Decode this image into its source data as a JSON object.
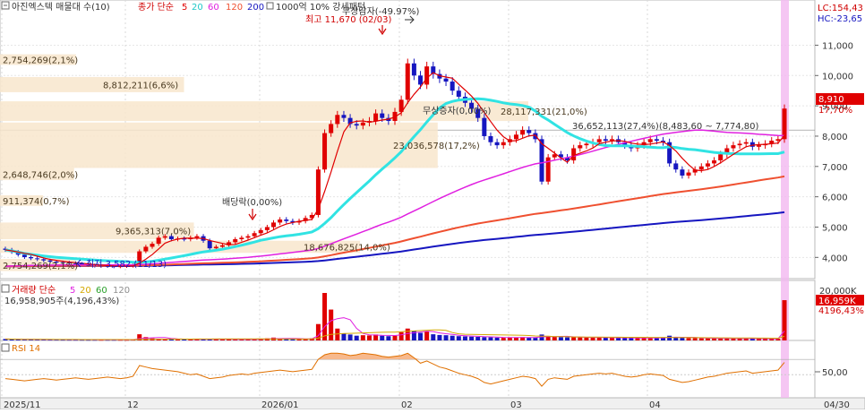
{
  "price_panel": {
    "title": "아진엑스텍 매물대 수(10)",
    "legend": {
      "ma_prefix": "종가 단순",
      "ma_periods": [
        "5",
        "20",
        "60",
        "120",
        "200"
      ],
      "ma_colors": [
        "#e00000",
        "#31e3e3",
        "#e020e0",
        "#ef5030",
        "#1616c0"
      ],
      "note": "1000억 10% 강세패턴"
    },
    "markers": {
      "high": "최고 11,670 (02/03)",
      "low": "최저 3,582 (11/13)",
      "capital_reduction": "무상감자(-49.97%)",
      "dividend": "배당락(0,00%)",
      "bonus_issue": "무상증자(0,00%)"
    },
    "range_label": "36,652,113(27,4%)(8,483,60 ~ 7,774,80)",
    "right_box": {
      "lc": "LC:154,43",
      "hc": "HC:-23,65",
      "price": "8,910",
      "change": "17,70%"
    },
    "y_ticks": [
      "11,000",
      "10,000",
      "9,000",
      "8,000",
      "7,000",
      "6,000",
      "5,000",
      "4,000"
    ]
  },
  "volume_panel": {
    "title_prefix": "거래량 단순",
    "ma_periods": [
      "5",
      "20",
      "60",
      "120"
    ],
    "ma_colors": [
      "#e020e0",
      "#e8c000",
      "#2aa02a",
      "#909090"
    ],
    "info": "16,958,905주(4,196,43%)",
    "y_tick": "20,000K",
    "last_value": "16,959K",
    "last_pct": "4196,43%"
  },
  "rsi_panel": {
    "title": "RSI 14",
    "y_tick": "50,00"
  },
  "x_axis": {
    "labels": [
      "2025/11",
      "12",
      "2026/01",
      "02",
      "03",
      "04",
      "04/30"
    ]
  },
  "chart_data": {
    "type": "candlestick",
    "y_axis_ticks": [
      4000,
      5000,
      6000,
      7000,
      8000,
      9000,
      10000,
      11000
    ],
    "ylim": [
      3300,
      11900
    ],
    "last_price": 8910,
    "high": {
      "value": 11670,
      "date": "02/03"
    },
    "low": {
      "value": 3582,
      "date": "11/13"
    },
    "volume_profile": [
      {
        "volume": "2,754,269",
        "pct": "2,1%",
        "price_low": 10350,
        "price_high": 10700
      },
      {
        "volume": "8,812,211",
        "pct": "6,6%",
        "price_low": 9450,
        "price_high": 9950
      },
      {
        "volume": "28,117,331",
        "pct": "21,0%",
        "price_low": 8500,
        "price_high": 9150
      },
      {
        "volume": "23,036,578",
        "pct": "17,2%",
        "price_low": 6950,
        "price_high": 8450
      },
      {
        "volume": "2,648,746",
        "pct": "2,0%",
        "price_low": 6550,
        "price_high": 6950
      },
      {
        "volume": "911,374",
        "pct": "0,7%",
        "price_low": 5700,
        "price_high": 6050
      },
      {
        "volume": "9,365,313",
        "pct": "7,0%",
        "price_low": 4600,
        "price_high": 5150
      },
      {
        "volume": "18,676,825",
        "pct": "14,0%",
        "price_low": 4150,
        "price_high": 4550
      },
      {
        "volume": "2,754,269",
        "pct": "2,1%",
        "price_low": 3550,
        "price_high": 3950
      }
    ],
    "closes": [
      4250,
      4180,
      4090,
      4010,
      3970,
      3940,
      3900,
      3860,
      3840,
      3830,
      3810,
      3790,
      3760,
      3740,
      3720,
      3720,
      3710,
      3700,
      3710,
      3720,
      3740,
      4200,
      4350,
      4450,
      4650,
      4700,
      4600,
      4620,
      4600,
      4650,
      4700,
      4550,
      4300,
      4350,
      4400,
      4500,
      4600,
      4650,
      4700,
      4800,
      4900,
      5000,
      5150,
      5250,
      5200,
      5150,
      5200,
      5300,
      5400,
      6900,
      8100,
      8400,
      8700,
      8600,
      8400,
      8350,
      8450,
      8500,
      8750,
      8600,
      8500,
      8800,
      9200,
      10400,
      10000,
      9700,
      10300,
      10050,
      9900,
      9800,
      9500,
      9300,
      9100,
      8900,
      8600,
      8000,
      7800,
      7700,
      7800,
      7900,
      8050,
      8200,
      8100,
      7900,
      6500,
      7300,
      7400,
      7300,
      7200,
      7600,
      7700,
      7750,
      7800,
      7900,
      7850,
      7900,
      7800,
      7700,
      7600,
      7700,
      7800,
      7900,
      7850,
      7800,
      7100,
      6900,
      6700,
      6800,
      6900,
      7000,
      7100,
      7200,
      7400,
      7600,
      7700,
      7750,
      7800,
      7650,
      7700,
      7750,
      7850,
      7900,
      8910
    ],
    "volume_values_k": [
      600,
      500,
      450,
      420,
      400,
      380,
      380,
      360,
      350,
      340,
      330,
      320,
      320,
      300,
      300,
      300,
      300,
      300,
      300,
      300,
      350,
      2600,
      1400,
      900,
      700,
      600,
      550,
      500,
      480,
      460,
      450,
      700,
      600,
      500,
      480,
      460,
      500,
      480,
      460,
      450,
      700,
      900,
      1200,
      800,
      700,
      650,
      600,
      700,
      900,
      6900,
      20000,
      13000,
      5000,
      3000,
      2500,
      2000,
      2200,
      2100,
      2500,
      2000,
      1800,
      2000,
      3500,
      5000,
      4000,
      3200,
      3800,
      2600,
      2300,
      2200,
      2000,
      1800,
      1700,
      1600,
      1500,
      1400,
      1300,
      1200,
      1100,
      1200,
      1300,
      1400,
      1200,
      1100,
      2500,
      1900,
      1500,
      1400,
      1300,
      1400,
      1300,
      1250,
      1200,
      1200,
      1150,
      1100,
      1100,
      1100,
      1000,
      1000,
      1100,
      1150,
      1100,
      1050,
      2000,
      1400,
      1100,
      1000,
      950,
      900,
      900,
      850,
      800,
      800,
      800,
      780,
      760,
      740,
      720,
      700,
      700,
      720,
      16959
    ],
    "rsi_values": [
      45,
      44,
      43,
      42,
      43,
      44,
      45,
      44,
      43,
      44,
      45,
      46,
      45,
      44,
      45,
      46,
      47,
      46,
      45,
      46,
      48,
      62,
      60,
      58,
      57,
      56,
      55,
      54,
      52,
      50,
      51,
      48,
      45,
      46,
      47,
      49,
      50,
      51,
      50,
      52,
      53,
      54,
      55,
      56,
      55,
      54,
      55,
      56,
      57,
      70,
      76,
      78,
      78,
      77,
      75,
      76,
      78,
      77,
      76,
      74,
      73,
      74,
      75,
      78,
      72,
      65,
      68,
      64,
      60,
      58,
      55,
      52,
      50,
      48,
      45,
      40,
      38,
      40,
      42,
      44,
      46,
      48,
      47,
      45,
      35,
      44,
      46,
      45,
      44,
      48,
      49,
      50,
      51,
      52,
      51,
      52,
      50,
      48,
      47,
      48,
      50,
      51,
      50,
      49,
      44,
      42,
      40,
      41,
      43,
      45,
      47,
      48,
      50,
      52,
      53,
      54,
      55,
      52,
      53,
      54,
      55,
      56,
      66
    ]
  }
}
